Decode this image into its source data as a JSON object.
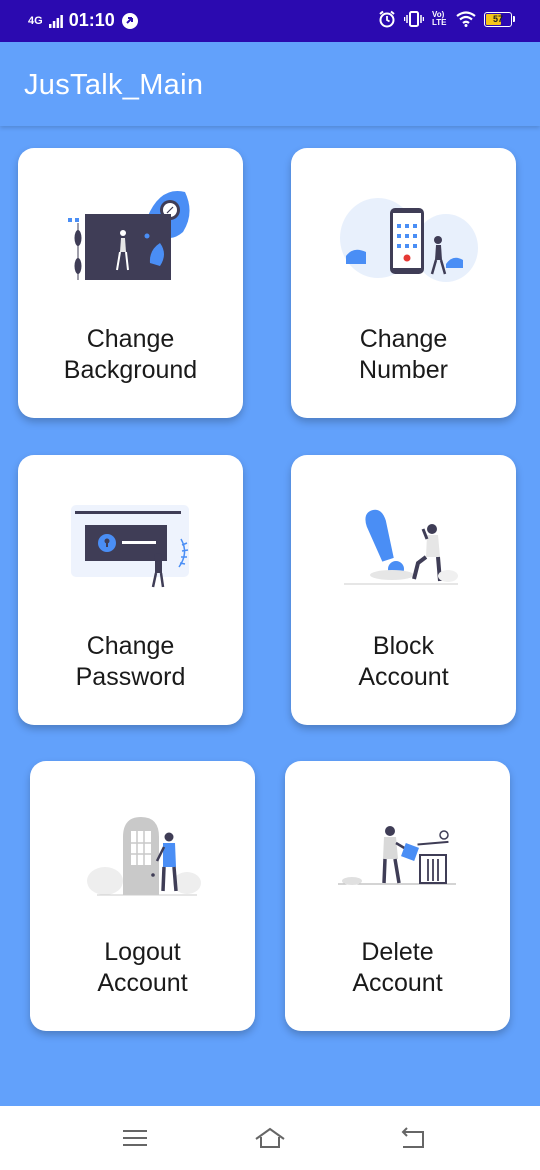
{
  "status_bar": {
    "network": "4G",
    "time": "01:10",
    "volte": "Vo) LTE",
    "battery": "57"
  },
  "app_bar": {
    "title": "JusTalk_Main"
  },
  "cards": [
    {
      "line1": "Change",
      "line2": "Background"
    },
    {
      "line1": "Change",
      "line2": "Number"
    },
    {
      "line1": "Change",
      "line2": "Password"
    },
    {
      "line1": "Block",
      "line2": "Account"
    },
    {
      "line1": "Logout",
      "line2": "Account"
    },
    {
      "line1": "Delete",
      "line2": "Account"
    }
  ],
  "colors": {
    "background": "#62a1fb",
    "status_bar": "#2b0ab0",
    "card": "#ffffff",
    "accent": "#4a8ef5",
    "dark": "#3f3d56"
  },
  "icons": {
    "card_0": "background-illustration-icon",
    "card_1": "phone-illustration-icon",
    "card_2": "password-illustration-icon",
    "card_3": "block-illustration-icon",
    "card_4": "logout-illustration-icon",
    "card_5": "delete-illustration-icon"
  }
}
